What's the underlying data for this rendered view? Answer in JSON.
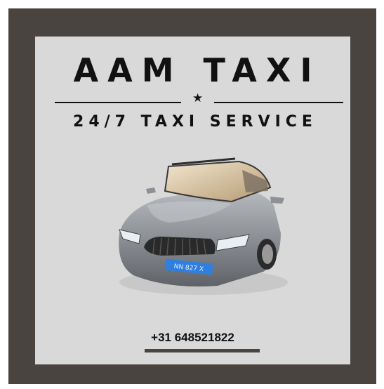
{
  "brand": {
    "title": "AAM TAXI",
    "subtitle": "24/7 TAXI SERVICE",
    "star": "★"
  },
  "car": {
    "plate": "NN 827 X",
    "icon": "taxi-car-icon"
  },
  "contact": {
    "phone": "+31 648521822"
  },
  "colors": {
    "frame": "#4a4441",
    "panel": "#d9d9d9",
    "text": "#111111",
    "plate": "#2f7fe0"
  }
}
